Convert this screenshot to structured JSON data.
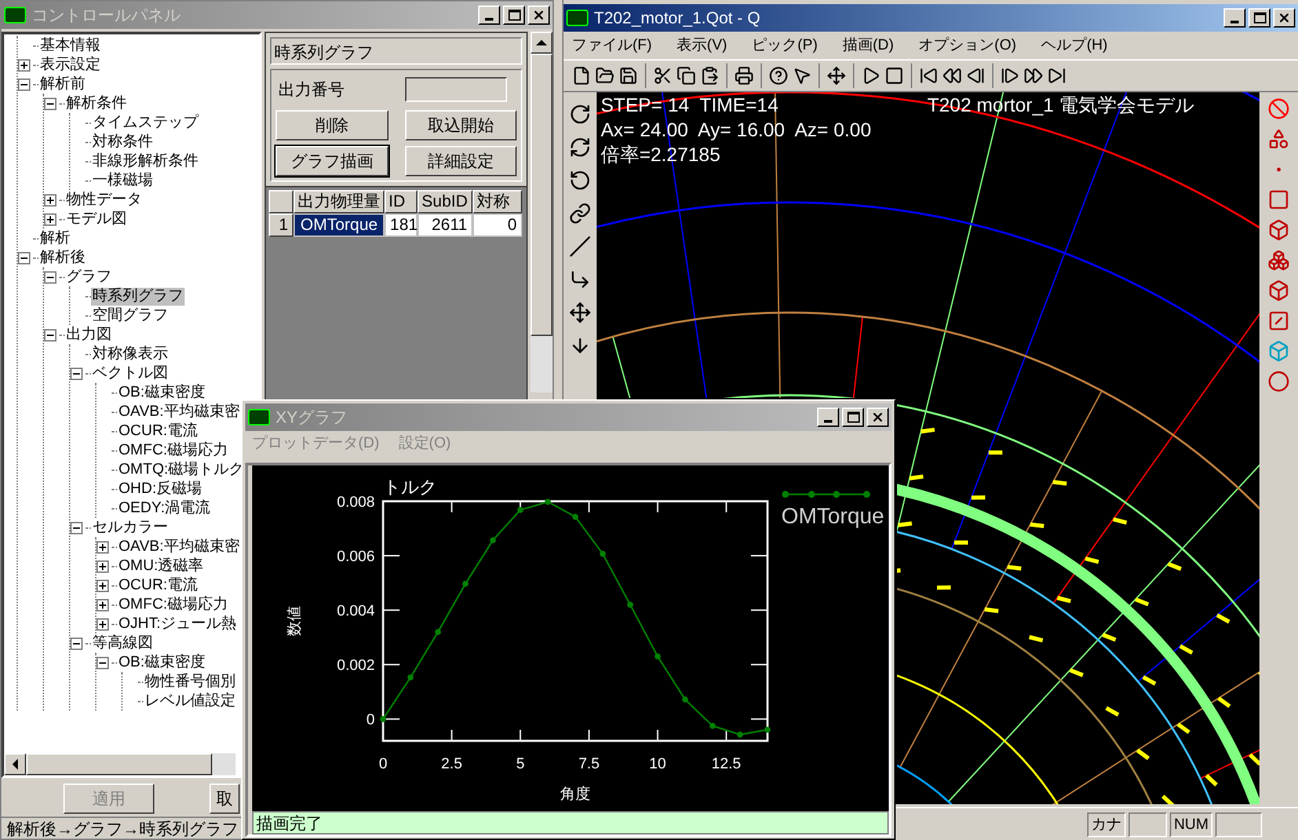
{
  "control_panel": {
    "title": "コントロールパネル",
    "active": false,
    "tree": [
      {
        "label": "基本情報",
        "selected": false
      },
      {
        "label": "表示設定",
        "selected": false,
        "expanded": false
      },
      {
        "label": "解析前",
        "selected": false,
        "expanded": true,
        "children": [
          {
            "label": "解析条件",
            "selected": false,
            "expanded": true,
            "children": [
              {
                "label": "タイムステップ",
                "selected": false
              },
              {
                "label": "対称条件",
                "selected": false
              },
              {
                "label": "非線形解析条件",
                "selected": false
              },
              {
                "label": "一様磁場",
                "selected": false
              }
            ]
          },
          {
            "label": "物性データ",
            "selected": false,
            "expanded": false
          },
          {
            "label": "モデル図",
            "selected": false,
            "expanded": false
          }
        ]
      },
      {
        "label": "解析",
        "selected": false
      },
      {
        "label": "解析後",
        "selected": false,
        "expanded": true,
        "children": [
          {
            "label": "グラフ",
            "selected": false,
            "expanded": true,
            "children": [
              {
                "label": "時系列グラフ",
                "selected": true
              },
              {
                "label": "空間グラフ",
                "selected": false
              }
            ]
          },
          {
            "label": "出力図",
            "selected": false,
            "expanded": true,
            "children": [
              {
                "label": "対称像表示",
                "selected": false
              },
              {
                "label": "ベクトル図",
                "selected": false,
                "expanded": true,
                "children": [
                  {
                    "label": "OB:磁束密度",
                    "selected": false
                  },
                  {
                    "label": "OAVB:平均磁束密",
                    "selected": false
                  },
                  {
                    "label": "OCUR:電流",
                    "selected": false
                  },
                  {
                    "label": "OMFC:磁場応力",
                    "selected": false
                  },
                  {
                    "label": "OMTQ:磁場トルク",
                    "selected": false
                  },
                  {
                    "label": "OHD:反磁場",
                    "selected": false
                  },
                  {
                    "label": "OEDY:渦電流",
                    "selected": false
                  }
                ]
              },
              {
                "label": "セルカラー",
                "selected": false,
                "expanded": true,
                "children": [
                  {
                    "label": "OAVB:平均磁束密",
                    "selected": false,
                    "expanded": false
                  },
                  {
                    "label": "OMU:透磁率",
                    "selected": false,
                    "expanded": false
                  },
                  {
                    "label": "OCUR:電流",
                    "selected": false,
                    "expanded": false
                  },
                  {
                    "label": "OMFC:磁場応力",
                    "selected": false,
                    "expanded": false
                  },
                  {
                    "label": "OJHT:ジュール熱",
                    "selected": false,
                    "expanded": false
                  }
                ]
              },
              {
                "label": "等高線図",
                "selected": false,
                "expanded": true,
                "children": [
                  {
                    "label": "OB:磁束密度",
                    "selected": false,
                    "expanded": true,
                    "children": [
                      {
                        "label": "物性番号個別",
                        "selected": false
                      },
                      {
                        "label": "レベル値設定",
                        "selected": false
                      }
                    ]
                  }
                ]
              }
            ]
          }
        ]
      }
    ],
    "panel_title": "時系列グラフ",
    "output_number": {
      "label": "出力番号"
    },
    "buttons": [
      {
        "label": "削除",
        "default": false
      },
      {
        "label": "取込開始",
        "default": false
      },
      {
        "label": "グラフ描画",
        "default": true
      },
      {
        "label": "詳細設定",
        "default": false
      }
    ],
    "table": {
      "columns": [
        "出力物理量",
        "ID",
        "SubID",
        "対称"
      ],
      "rows": [
        {
          "index": "1",
          "cells": [
            "OMTorque",
            "181",
            "2611",
            "0"
          ],
          "selected": true
        }
      ]
    },
    "footer_buttons": [
      {
        "label": "適用",
        "disabled": true
      },
      {
        "label": "取",
        "disabled": false
      }
    ],
    "status": "解析後→グラフ→時系列グラフ"
  },
  "view_window": {
    "title": "T202_motor_1.Qot - Q",
    "active": true,
    "menu": [
      "ファイル(F)",
      "表示(V)",
      "ピック(P)",
      "描画(D)",
      "オプション(O)",
      "ヘルプ(H)"
    ],
    "overlay": {
      "step": "STEP= 14  TIME=14",
      "model": "T202 mortor_1 電気学会モデル",
      "axes": "Ax= 24.00  Ay= 16.00  Az= 0.00",
      "scale": "倍率=2.27185"
    },
    "status_panes": [
      "カナ",
      "NUM"
    ]
  },
  "xy_graph": {
    "title": "XYグラフ",
    "active": false,
    "menu": [
      "プロットデータ(D)",
      "設定(O)"
    ],
    "chart_data": {
      "type": "line",
      "title": "トルク",
      "xlabel": "角度",
      "ylabel": "数値",
      "x": [
        0,
        1,
        2,
        3,
        4,
        5,
        6,
        7,
        8,
        9,
        10,
        11,
        12,
        13,
        14
      ],
      "series": [
        {
          "name": "OMTorque",
          "color": "#008000",
          "marker": "circle",
          "values": [
            0,
            0.00153,
            0.0032,
            0.00497,
            0.00657,
            0.00768,
            0.00798,
            0.00743,
            0.00607,
            0.0042,
            0.0023,
            0.00072,
            -0.00025,
            -0.00057,
            -0.00039
          ]
        }
      ],
      "xlim": [
        0,
        14
      ],
      "ylim": [
        -0.0008,
        0.008
      ],
      "xticks": [
        0,
        {
          "value": 2.5,
          "label": "2.5"
        },
        5,
        {
          "value": 7.5,
          "label": "7.5"
        },
        10,
        {
          "value": 12.5,
          "label": "12.5"
        }
      ],
      "yticks": [
        0,
        {
          "value": 0.002,
          "label": "0.002"
        },
        {
          "value": 0.004,
          "label": "0.004"
        },
        {
          "value": 0.006,
          "label": "0.006"
        },
        {
          "value": 0.008,
          "label": "0.008"
        }
      ]
    },
    "status": "描画完了"
  }
}
